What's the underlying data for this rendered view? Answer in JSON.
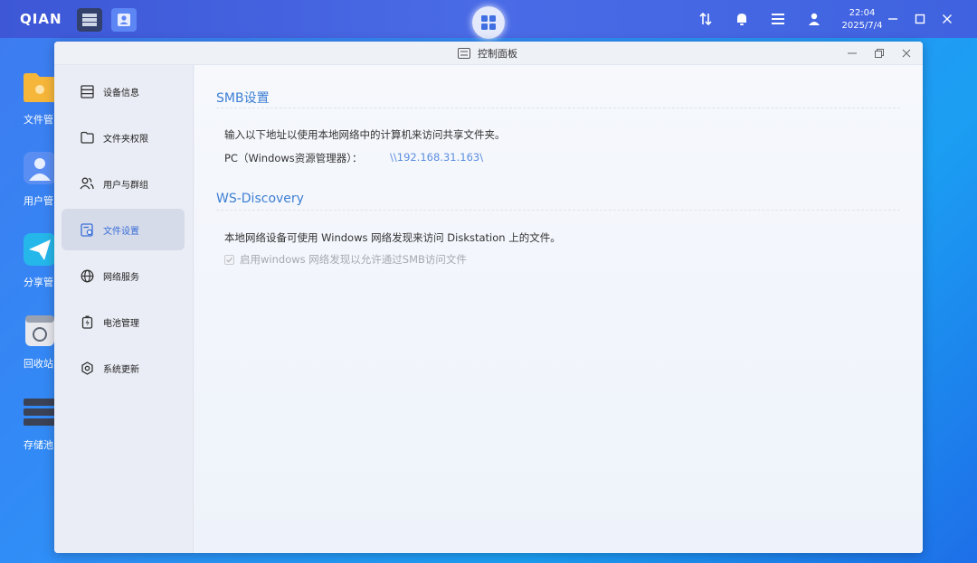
{
  "topbar": {
    "logo": "QIAN",
    "time": "22:04",
    "date": "2025/7/4",
    "icons": [
      "sort-arrows-icon",
      "bell-icon",
      "list-settings-icon",
      "user-icon"
    ]
  },
  "desktop": {
    "icons": [
      {
        "label": "文件管",
        "icon": "folder-icon"
      },
      {
        "label": "用户管",
        "icon": "user-icon"
      },
      {
        "label": "分享管",
        "icon": "send-icon"
      },
      {
        "label": "回收站",
        "icon": "recycle-icon"
      },
      {
        "label": "存储池",
        "icon": "storage-icon"
      }
    ]
  },
  "window": {
    "title": "控制面板",
    "sidebar": {
      "items": [
        {
          "label": "设备信息",
          "icon": "server-icon"
        },
        {
          "label": "文件夹权限",
          "icon": "folder-icon"
        },
        {
          "label": "用户与群组",
          "icon": "users-icon"
        },
        {
          "label": "文件设置",
          "icon": "file-settings-icon",
          "active": true
        },
        {
          "label": "网络服务",
          "icon": "globe-icon"
        },
        {
          "label": "电池管理",
          "icon": "battery-icon"
        },
        {
          "label": "系统更新",
          "icon": "update-icon"
        }
      ]
    },
    "smb": {
      "title": "SMB设置",
      "description": "输入以下地址以使用本地网络中的计算机来访问共享文件夹。",
      "pc_label": "PC（Windows资源管理器）：",
      "pc_address": "\\\\192.168.31.163\\"
    },
    "ws": {
      "title": "WS-Discovery",
      "description": "本地网络设备可使用 Windows 网络发现来访问 Diskstation 上的文件。",
      "checkbox_label": "启用windows 网络发现以允许通过SMB访问文件",
      "checkbox_checked": true,
      "checkbox_disabled": true
    }
  }
}
